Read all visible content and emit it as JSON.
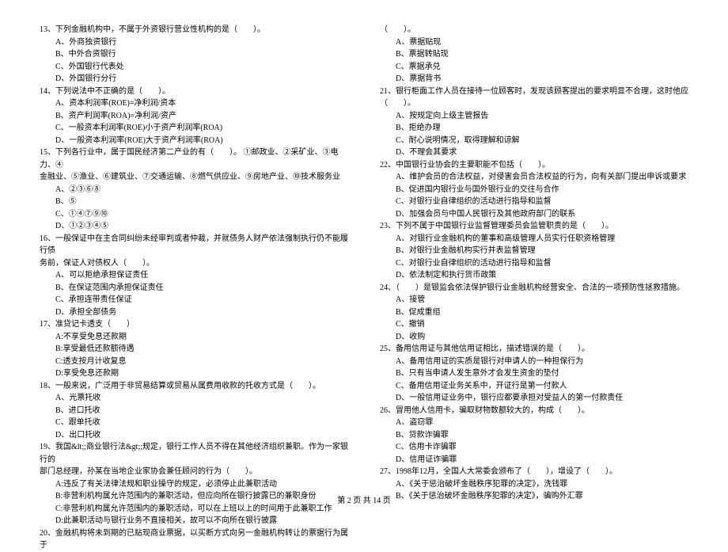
{
  "left": {
    "q13": {
      "stem": "13、下列金融机构中，不属于外资银行营业性机构的是（　　）。",
      "opts": [
        "A、外商独资银行",
        "B、中外合资银行",
        "C、外国银行代表处",
        "D、外国银行分行"
      ]
    },
    "q14": {
      "stem": "14、下列说法中不正确的是（　　）。",
      "opts": [
        "A、资本利润率(ROE)=净利润/资本",
        "B、资产利润率(ROA)=净利润/资产",
        "C、一般资本利润率(ROE)小于资产利润率(ROA)",
        "D、一般资本利润率(ROE)大于资产利润率(ROA)"
      ]
    },
    "q15": {
      "stem1": "15、下列各行业中，属于国民经济第二产业的有（　　）。 ①邮政业、②采矿业、③电力、④",
      "stem2": "金融业、⑤渔业、⑥建筑业、⑦交通运输、⑧燃气供应业、⑨房地产业、⑩技术服务业",
      "opts": [
        "A、②③⑥⑧",
        "B、⑤",
        "C、①④⑦⑨⑩",
        "D、①②③④⑤"
      ]
    },
    "q16": {
      "stem1": "16、一般保证中在主合同纠纷未经审判或者仲裁，并就债务人财产依法强制执行仍不能履行债",
      "stem2": "务前，保证人对债权人（　　）。",
      "opts": [
        "A、可以拒绝承担保证责任",
        "B、在保证范围内承担保证责任",
        "C、承担连带责任保证",
        "D、承担全部债务"
      ]
    },
    "q17": {
      "stem": "17、准贷记卡透支（　　）",
      "opts": [
        "A:不享受免息还款期",
        "B:享受最低还款额待遇",
        "C:透支按月计收复息",
        "D:享受免息还款期"
      ]
    },
    "q18": {
      "stem": "18、一般来说，广泛用于非贸易结算或贸易从属费用收款的托收方式是（　　）。",
      "opts": [
        "A、光票托收",
        "B、进口托收",
        "C、跟单托收",
        "D、出口托收"
      ]
    },
    "q19": {
      "stem1": "19、我国&lt;;商业银行法&gt;;规定，银行工作人员不得在其他经济组织兼职。作为一家银行的",
      "stem2": "部门总经理，孙某在当地企业家协会兼任顾问的行为（　　）。",
      "opts": [
        "A:违反了有关法律法规和职业操守的规定，必须停止此兼职活动",
        "B:非营利机构属允许范围内的兼职活动，但应向所在银行披露已的兼职身份",
        "C:非营利机构属允许范围内的兼职活动，可以在上班以上的时间用于此兼职工作",
        "D:此兼职活动与银行业务不直接相关，故可以不向所在银行披露"
      ]
    },
    "q20": {
      "stem": "20、金融机构将未到期的已贴现商业票据，以买断方式向另一金融机构转让的票据行为属于"
    }
  },
  "right": {
    "q20": {
      "stem": "（　　）。",
      "opts": [
        "A、票据贴现",
        "B、票据转贴现",
        "C、票据承兑",
        "D、票据背书"
      ]
    },
    "q21": {
      "stem1": "21、银行柜面工作人员在接待一位顾客时，发现该顾客提出的要求明显不合理，这时他应",
      "stem2": "（　　）。",
      "opts": [
        "A、按规定向上级主管报告",
        "B、拒绝办理",
        "C、耐心说明情况，取得理解和谅解",
        "D、不理会其要求"
      ]
    },
    "q22": {
      "stem": "22、中国银行业协会的主要职能不包括（　　）。",
      "opts": [
        "A、维护会员的合法权益，对侵害会员合法权益的行为，向有关部门提出申诉或要求",
        "B、促进国内银行业与国外银行业的交往与合作",
        "C、对银行业自律组织的活动进行指导和监督",
        "D、加强会员与中国人民银行及其他政府部门的联系"
      ]
    },
    "q23": {
      "stem": "23、下列不属于中国银行业监督管理委员会监管职责的是（　　）。",
      "opts": [
        "A、对银行业金融机构的董事和高级管理人员实行任职资格管理",
        "B、对银行业金融机构实行并表监督管理",
        "C、对银行业自律组织的活动进行指导和监督",
        "D、依法制定和执行货币政策"
      ]
    },
    "q24": {
      "stem": "24、（　　）是银监会依法保护银行业金融机构经营安全、合法的一项预防性拯救措施。",
      "opts": [
        "A、接管",
        "B、促成重组",
        "C、撤销",
        "D、收购"
      ]
    },
    "q25": {
      "stem": "25、备用信用证与其他信用证相比，描述错误的是（　　）。",
      "opts": [
        "A、备用信用证的实质是银行对申请人的一种担保行为",
        "B、只有当申请人发生意外才会发生资金的垫付",
        "C、备用信用证业务关系中，开证行是第一付款人",
        "D、一般信用证业务中，银行应都要承担对受益人的第一付款责任"
      ]
    },
    "q26": {
      "stem": "26、冒用他人信用卡，骗取财物数额较大的，构成（　　）。",
      "opts": [
        "A、盗窃罪",
        "B、贷款诈骗罪",
        "C、信用卡诈骗罪",
        "D、信用证诈骗罪"
      ]
    },
    "q27": {
      "stem": "27、1998年12月，全国人大常委会颁布了（　　），增设了（　　）。",
      "opts": [
        "A、《关于惩治破坏金融秩序犯罪的决定》，洗钱罪",
        "B、《关于惩治破坏金融秩序犯罪的决定》，骗购外汇罪"
      ]
    }
  },
  "footer": "第 2 页 共 14 页"
}
